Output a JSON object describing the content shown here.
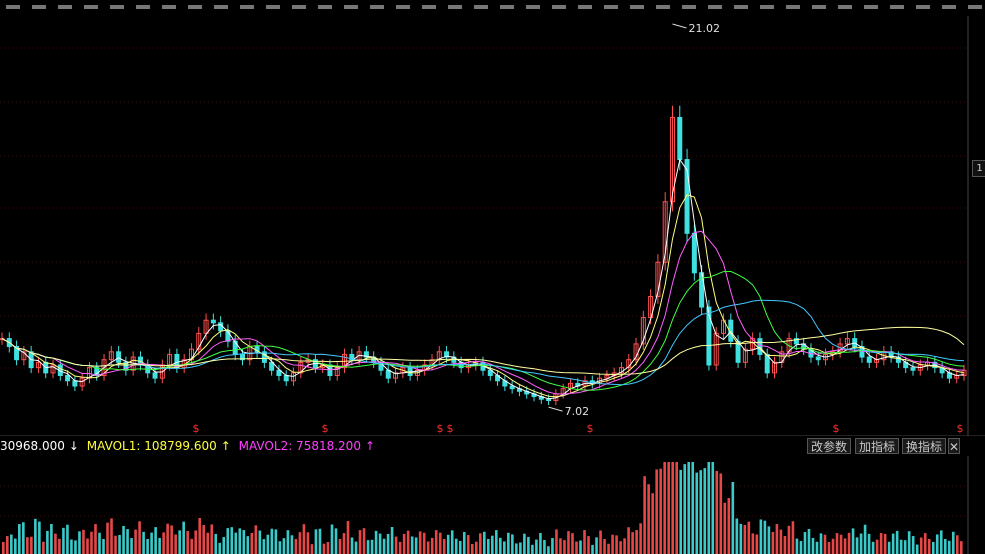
{
  "chart_data": {
    "type": "line",
    "description_kind": "candlestick-with-moving-averages-and-volume",
    "price_panel": {
      "annotations": [
        {
          "label": "21.02",
          "kind": "high"
        },
        {
          "label": "7.02",
          "kind": "low"
        }
      ],
      "signal_marker": "$",
      "signal_color": "#ff3030",
      "close_series": [
        9.4,
        9.1,
        8.6,
        8.9,
        8.3,
        8.5,
        8.1,
        8.4,
        8.0,
        7.8,
        7.6,
        7.9,
        8.3,
        8.0,
        8.6,
        8.9,
        8.5,
        8.2,
        8.7,
        8.4,
        8.1,
        7.9,
        8.4,
        8.8,
        8.3,
        8.6,
        9.0,
        9.6,
        10.1,
        10.0,
        9.7,
        9.3,
        8.8,
        8.6,
        9.1,
        8.9,
        8.5,
        8.2,
        8.0,
        7.8,
        8.1,
        8.5,
        8.6,
        8.3,
        8.4,
        8.0,
        8.3,
        8.8,
        8.6,
        8.9,
        8.7,
        8.5,
        8.2,
        7.9,
        8.1,
        8.3,
        8.0,
        8.2,
        8.4,
        8.6,
        8.9,
        8.7,
        8.5,
        8.3,
        8.4,
        8.5,
        8.2,
        8.0,
        7.8,
        7.6,
        7.5,
        7.4,
        7.3,
        7.2,
        7.1,
        7.05,
        7.3,
        7.5,
        7.7,
        7.6,
        7.8,
        7.7,
        7.9,
        8.0,
        8.1,
        8.3,
        8.6,
        9.2,
        10.2,
        11.0,
        12.3,
        14.6,
        17.8,
        16.2,
        13.4,
        11.9,
        10.6,
        8.4,
        9.6,
        10.1,
        9.3,
        8.5,
        9.0,
        9.4,
        8.8,
        8.1,
        8.5,
        8.9,
        9.4,
        9.2,
        9.0,
        8.7,
        8.6,
        8.8,
        8.9,
        9.2,
        9.4,
        9.1,
        8.7,
        8.5,
        8.6,
        8.9,
        8.7,
        8.5,
        8.3,
        8.2,
        8.4,
        8.5,
        8.3,
        8.1,
        7.9,
        8.0,
        8.2
      ]
    },
    "volume_panel": {
      "labels": {
        "vol": "30968.000",
        "vol_arrow": "↓",
        "mavol1": "MAVOL1: 108799.600",
        "mavol1_arrow": "↑",
        "mavol2": "MAVOL2: 75818.200",
        "mavol2_arrow": "↑"
      },
      "colors": {
        "vol": "#ffffff",
        "mavol1": "#ffff40",
        "mavol2": "#ff40ff"
      }
    },
    "colors": {
      "up": "#ff5050",
      "down": "#40e0e0",
      "ma_white": "#ffffff",
      "ma_yellow": "#ffff80",
      "ma_magenta": "#ff60ff",
      "ma_green": "#40ff40",
      "ma_cyan": "#40c8ff",
      "grid": "#2a2a2a"
    }
  },
  "toolbar": {
    "change_params": "改参数",
    "add_indicator": "加指标",
    "switch_indicator": "换指标",
    "close": "✕"
  },
  "right_scale_label": "1"
}
